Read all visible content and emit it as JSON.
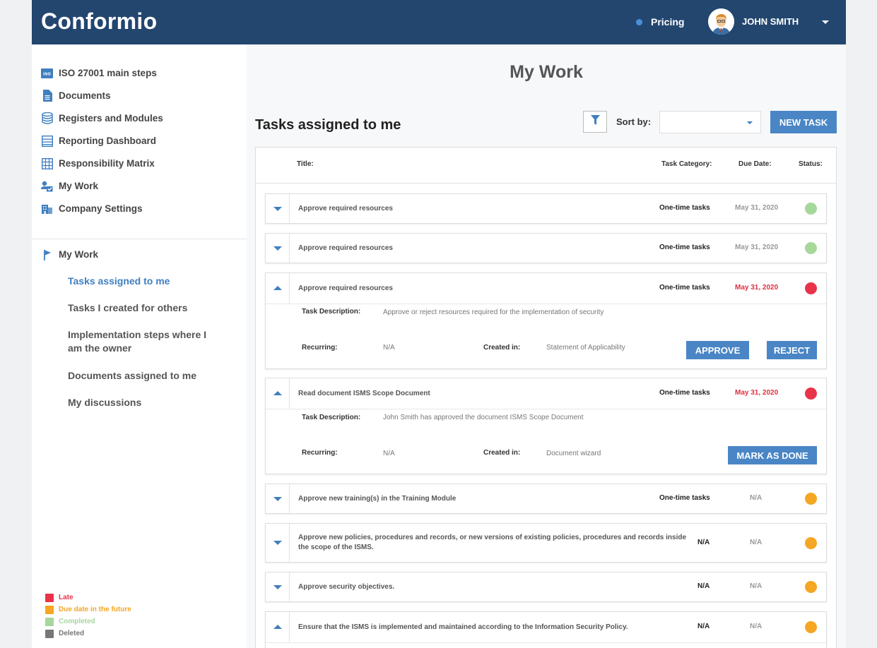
{
  "header": {
    "logo": "Conformio",
    "pricing": "Pricing",
    "user_name": "JOHN SMITH"
  },
  "sidebar": {
    "items": [
      {
        "label": "ISO 27001 main steps",
        "icon": "iso-icon"
      },
      {
        "label": "Documents",
        "icon": "document-icon"
      },
      {
        "label": "Registers and Modules",
        "icon": "database-icon"
      },
      {
        "label": "Reporting Dashboard",
        "icon": "dashboard-icon"
      },
      {
        "label": "Responsibility Matrix",
        "icon": "matrix-icon"
      },
      {
        "label": "My Work",
        "icon": "user-check-icon"
      },
      {
        "label": "Company Settings",
        "icon": "building-icon"
      }
    ],
    "section": {
      "label": "My Work",
      "icon": "flag-icon"
    },
    "sub_items": [
      {
        "label": "Tasks assigned to me",
        "active": true
      },
      {
        "label": "Tasks I created for others"
      },
      {
        "label": "Implementation steps where I am the owner"
      },
      {
        "label": "Documents assigned to me"
      },
      {
        "label": "My discussions"
      }
    ],
    "legend": [
      {
        "label": "Late",
        "color": "#e8334a"
      },
      {
        "label": "Due date in the future",
        "color": "#f5a623"
      },
      {
        "label": "Completed",
        "color": "#a6d79b"
      },
      {
        "label": "Deleted",
        "color": "#777777"
      }
    ]
  },
  "main": {
    "title": "My Work",
    "section_title": "Tasks assigned to me",
    "sort_label": "Sort by:",
    "sort_value": "",
    "new_task": "NEW TASK",
    "columns": {
      "title": "Title:",
      "category": "Task Category:",
      "due": "Due Date:",
      "status": "Status:"
    },
    "tasks": [
      {
        "title": "Approve required resources",
        "category": "One-time tasks",
        "due": "May 31, 2020",
        "status": "completed",
        "expanded": false
      },
      {
        "title": "Approve required resources",
        "category": "One-time tasks",
        "due": "May 31, 2020",
        "status": "completed",
        "expanded": false
      },
      {
        "title": "Approve required resources",
        "category": "One-time tasks",
        "due": "May 31, 2020",
        "status": "late",
        "expanded": true,
        "desc_label": "Task Description:",
        "desc": "Approve or reject resources required for the implementation of security",
        "recurring_label": "Recurring:",
        "recurring": "N/A",
        "created_label": "Created in:",
        "created": "Statement of Applicability",
        "actions": [
          "APPROVE",
          "REJECT"
        ]
      },
      {
        "title": "Read document ISMS Scope Document",
        "category": "One-time tasks",
        "due": "May 31, 2020",
        "status": "late",
        "expanded": true,
        "desc_label": "Task Description:",
        "desc": "John Smith has approved the document ISMS Scope Document",
        "recurring_label": "Recurring:",
        "recurring": "N/A",
        "created_label": "Created in:",
        "created": "Document wizard",
        "actions": [
          "MARK AS DONE"
        ]
      },
      {
        "title": "Approve new training(s) in the Training Module",
        "category": "One-time tasks",
        "due": "N/A",
        "status": "future",
        "expanded": false
      },
      {
        "title": "Approve new policies, procedures and records, or new versions of existing policies, procedures and records inside the scope of the ISMS.",
        "category": "N/A",
        "due": "N/A",
        "status": "future",
        "expanded": false
      },
      {
        "title": "Approve security objectives.",
        "category": "N/A",
        "due": "N/A",
        "status": "future",
        "expanded": false
      },
      {
        "title": "Ensure that the ISMS is implemented and maintained according to the Information Security Policy.",
        "category": "N/A",
        "due": "N/A",
        "status": "future",
        "expanded": true
      }
    ]
  },
  "colors": {
    "brand": "#23466f",
    "accent": "#4a86c5",
    "late": "#e8334a",
    "future": "#f5a623",
    "completed": "#a6d79b",
    "deleted": "#777777"
  }
}
